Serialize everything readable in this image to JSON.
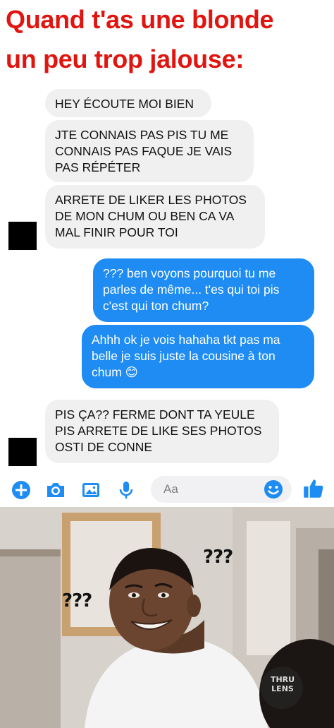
{
  "meme": {
    "title_line1": "Quand t'as une blonde",
    "title_line2": "un peu trop jalouse:"
  },
  "messages": [
    {
      "side": "in",
      "text": "HEY ÉCOUTE MOI BIEN"
    },
    {
      "side": "in",
      "text": "JTE CONNAIS PAS PIS TU ME\nCONNAIS PAS FAQUE JE VAIS\nPAS RÉPÉTER"
    },
    {
      "side": "in",
      "text": "ARRETE DE LIKER LES PHOTOS\nDE MON CHUM OU BEN CA VA\nMAL FINIR POUR TOI"
    },
    {
      "side": "out",
      "text": "??? ben voyons pourquoi tu me\nparles de même... t'es qui toi pis\nc'est qui ton chum?"
    },
    {
      "side": "out",
      "text": "Ahhh ok je vois hahaha tkt pas ma\nbelle je suis juste la cousine à ton\nchum 😊"
    },
    {
      "side": "in",
      "text": "PIS ÇA?? FERME DONT TA YEULE\nPIS ARRETE DE LIKE SES PHOTOS\nOSTI DE CONNE"
    }
  ],
  "composer": {
    "placeholder": "Aa",
    "icons": [
      "plus-icon",
      "camera-icon",
      "image-icon",
      "microphone-icon",
      "emoji-icon",
      "thumbs-up-icon"
    ],
    "accent": "#1e8cf3"
  },
  "photo": {
    "question_marks_left": "???",
    "question_marks_right": "???",
    "watermark": "THRU LENS"
  },
  "colors": {
    "title": "#e0150f",
    "incoming_bubble": "#f1f0f0",
    "outgoing_bubble": "#1e8cf3"
  }
}
